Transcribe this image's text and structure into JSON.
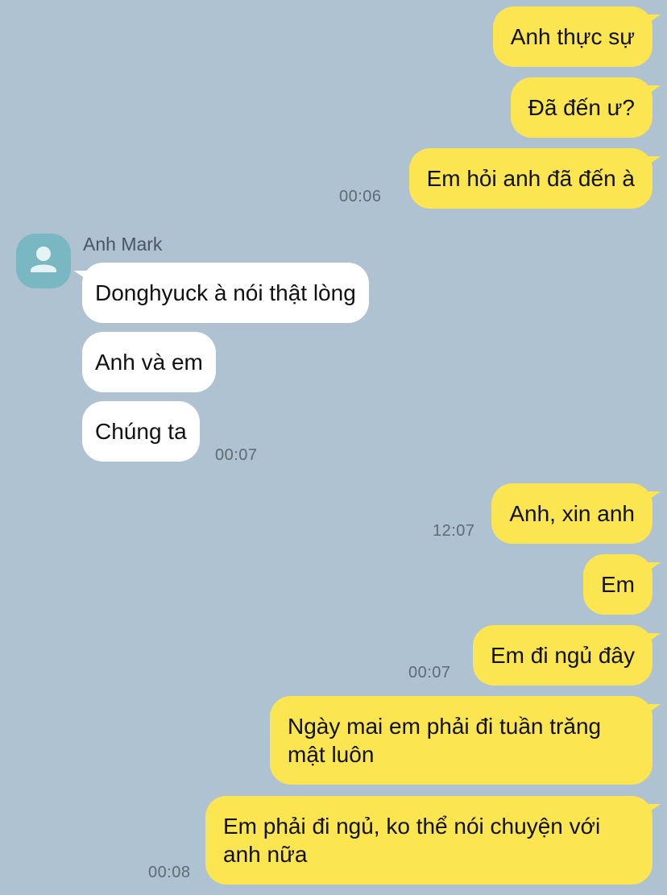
{
  "colors": {
    "background": "#afc2d2",
    "outgoing_bubble": "#fbe551",
    "incoming_bubble": "#ffffff",
    "avatar": "#79b8c3",
    "timestamp": "#5e6a74"
  },
  "contact": {
    "name": "Anh Mark",
    "avatar_icon": "person-silhouette-icon"
  },
  "messages": [
    {
      "text": "Anh thực sự"
    },
    {
      "text": "Đã đến ư?"
    },
    {
      "text": "Em hỏi anh đã đến à",
      "time": "00:06"
    },
    {
      "text": "Donghyuck à nói thật lòng"
    },
    {
      "text": "Anh và em"
    },
    {
      "text": "Chúng ta",
      "time": "00:07"
    },
    {
      "text": "Anh, xin anh",
      "time": "12:07"
    },
    {
      "text": "Em"
    },
    {
      "text": "Em đi ngủ đây",
      "time": "00:07"
    },
    {
      "text": "Ngày mai em phải đi tuần trăng mật luôn"
    },
    {
      "text": "Em phải đi ngủ, ko thể nói chuyện với anh nữa",
      "time": "00:08"
    }
  ]
}
